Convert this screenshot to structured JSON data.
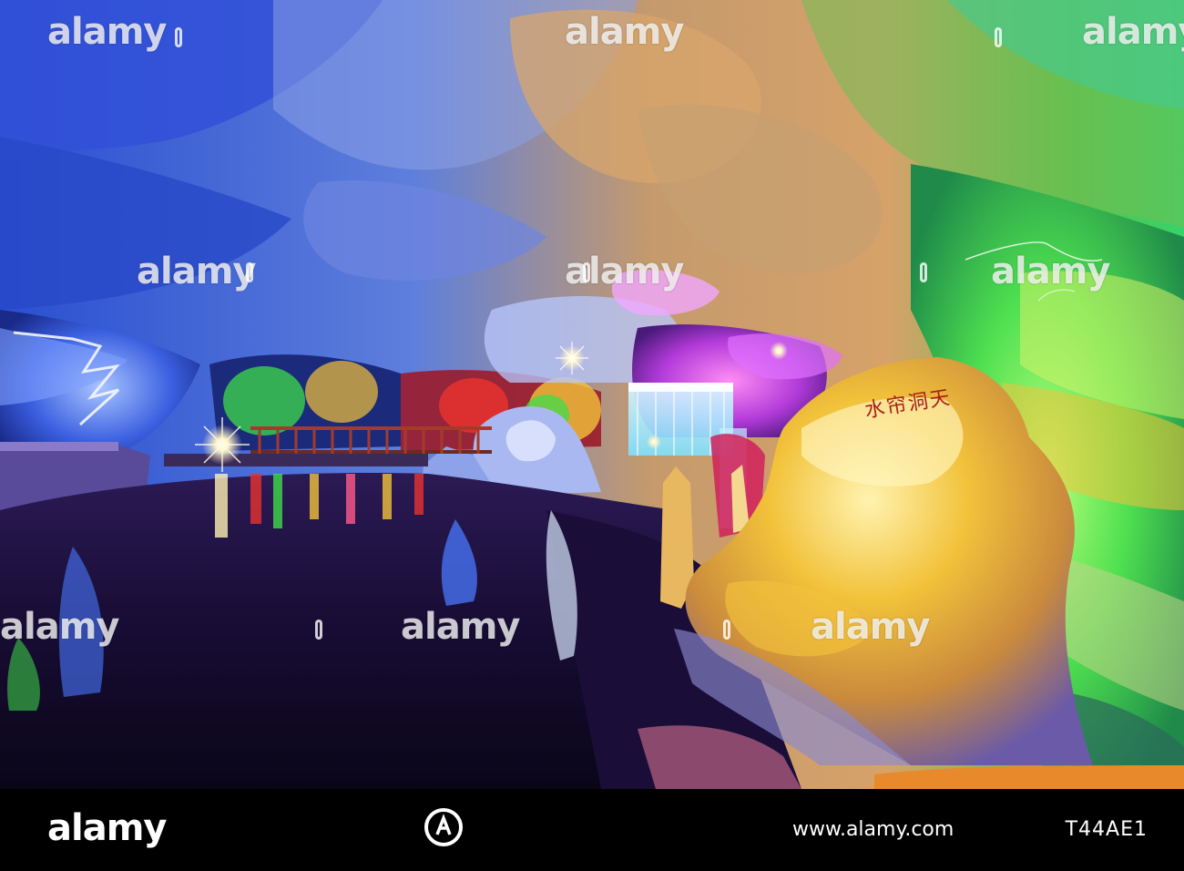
{
  "image": {
    "description_colors": {
      "cave_blue": "#2a56d6",
      "cave_purple": "#8b3bd1",
      "cave_green": "#3fdc4a",
      "cave_yellow": "#f2c23a",
      "cave_orange": "#e8892b",
      "water_dark": "#130a2a",
      "sign_red": "#a8201a"
    }
  },
  "watermark": {
    "text": "alamy"
  },
  "sign": {
    "text": "水帘洞天"
  },
  "footer": {
    "logo": "alamy",
    "url": "www.alamy.com",
    "image_id": "T44AE1"
  }
}
